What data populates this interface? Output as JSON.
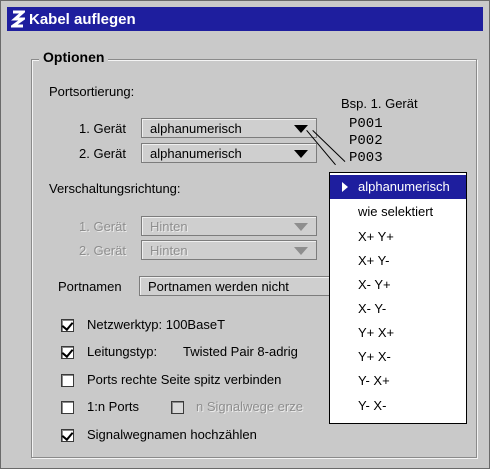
{
  "window": {
    "title": "Kabel auflegen"
  },
  "group": {
    "title": "Optionen"
  },
  "portsortierung": {
    "label": "Portsortierung:",
    "device1_label": "1. Gerät",
    "device1_value": "alphanumerisch",
    "device2_label": "2. Gerät",
    "device2_value": "alphanumerisch"
  },
  "example": {
    "label": "Bsp. 1. Gerät",
    "ports": [
      "P001",
      "P002",
      "P003"
    ]
  },
  "verschaltung": {
    "label": "Verschaltungsrichtung:",
    "device1_label": "1. Gerät",
    "device1_value": "Hinten",
    "device2_label": "2. Gerät",
    "device2_value": "Hinten"
  },
  "portnamen": {
    "label": "Portnamen",
    "button": "Portnamen werden nicht"
  },
  "checkboxes": {
    "netzwerktyp": {
      "label": "Netzwerktyp: 100BaseT",
      "checked": true
    },
    "leitungstyp": {
      "label": "Leitungstyp:",
      "value": "Twisted Pair 8-adrig",
      "checked": true
    },
    "ports_rechts": {
      "label": "Ports rechte Seite spitz verbinden",
      "checked": false
    },
    "one_n_ports": {
      "label": "1:n Ports",
      "checked": false
    },
    "n_signalwege": {
      "label": "n Signalwege erze",
      "checked": false
    },
    "signalwegnamen": {
      "label": "Signalwegnamen hochzählen",
      "checked": true
    }
  },
  "dropdown": {
    "selected_index": 0,
    "items": [
      "alphanumerisch",
      "wie selektiert",
      "X+ Y+",
      "X+ Y-",
      "X- Y+",
      "X- Y-",
      "Y+ X+",
      "Y+ X-",
      "Y- X+",
      "Y- X-"
    ]
  }
}
